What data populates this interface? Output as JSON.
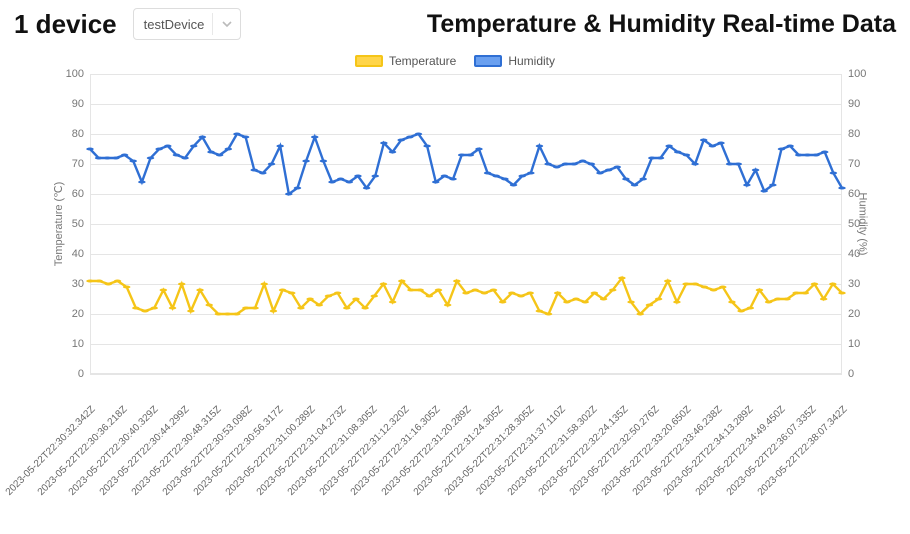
{
  "header": {
    "device_count_label": "1 device",
    "device_select_value": "testDevice",
    "chart_title": "Temperature & Humidity Real-time Data"
  },
  "legend": {
    "temperature": "Temperature",
    "humidity": "Humidity"
  },
  "axes": {
    "left_label": "Temperature (℃)",
    "right_label": "Humidity (%)"
  },
  "colors": {
    "temperature": "#f5c518",
    "humidity": "#2f6fd4",
    "grid": "#e5e5e5"
  },
  "chart_data": {
    "type": "line",
    "ylim": [
      0,
      100
    ],
    "ylabel_left": "Temperature (℃)",
    "ylabel_right": "Humidity (%)",
    "yticks": [
      0,
      10,
      20,
      30,
      40,
      50,
      60,
      70,
      80,
      90,
      100
    ],
    "categories": [
      "2023-05-22T22:30:32.342Z",
      "2023-05-22T22:30:36.218Z",
      "2023-05-22T22:30:40.329Z",
      "2023-05-22T22:30:44.299Z",
      "2023-05-22T22:30:48.315Z",
      "2023-05-22T22:30:53.098Z",
      "2023-05-22T22:30:56.317Z",
      "2023-05-22T22:31:00.289Z",
      "2023-05-22T22:31:04.273Z",
      "2023-05-22T22:31:08.305Z",
      "2023-05-22T22:31:12.320Z",
      "2023-05-22T22:31:16.305Z",
      "2023-05-22T22:31:20.289Z",
      "2023-05-22T22:31:24.305Z",
      "2023-05-22T22:31:28.305Z",
      "2023-05-22T22:31:37.110Z",
      "2023-05-22T22:31:58.302Z",
      "2023-05-22T22:32:24.135Z",
      "2023-05-22T22:32:50.276Z",
      "2023-05-22T22:33:20.650Z",
      "2023-05-22T22:33:46.238Z",
      "2023-05-22T22:34:13.289Z",
      "2023-05-22T22:34:49.450Z",
      "2023-05-22T22:36:07.335Z",
      "2023-05-22T22:38:07.342Z"
    ],
    "series": [
      {
        "name": "Temperature",
        "color": "#f5c518",
        "values": [
          31,
          31,
          30,
          31,
          29,
          22,
          21,
          22,
          28,
          22,
          30,
          21,
          28,
          23,
          20,
          20,
          20,
          22,
          22,
          30,
          21,
          28,
          27,
          22,
          25,
          23,
          26,
          27,
          22,
          25,
          22,
          26,
          30,
          24,
          31,
          28,
          28,
          26,
          28,
          23,
          31,
          27,
          28,
          27,
          28,
          24,
          27,
          26,
          27,
          21,
          20,
          27,
          24,
          25,
          24,
          27,
          25,
          28,
          32,
          24,
          20,
          23,
          25,
          31,
          24,
          30,
          30,
          29,
          28,
          29,
          24,
          21,
          22,
          28,
          24,
          25,
          25,
          27,
          27,
          30,
          25,
          30,
          27
        ]
      },
      {
        "name": "Humidity",
        "color": "#2f6fd4",
        "values": [
          75,
          72,
          72,
          72,
          73,
          71,
          64,
          72,
          75,
          76,
          73,
          72,
          76,
          79,
          74,
          73,
          75,
          80,
          79,
          68,
          67,
          70,
          76,
          60,
          62,
          71,
          79,
          71,
          64,
          65,
          64,
          66,
          62,
          66,
          77,
          74,
          78,
          79,
          80,
          76,
          64,
          66,
          65,
          73,
          73,
          75,
          67,
          66,
          65,
          63,
          66,
          67,
          76,
          70,
          69,
          70,
          70,
          71,
          70,
          67,
          68,
          69,
          65,
          63,
          65,
          72,
          72,
          76,
          74,
          73,
          70,
          78,
          76,
          77,
          70,
          70,
          63,
          68,
          61,
          63,
          75,
          76,
          73,
          73,
          73,
          74,
          67,
          62
        ]
      }
    ]
  }
}
